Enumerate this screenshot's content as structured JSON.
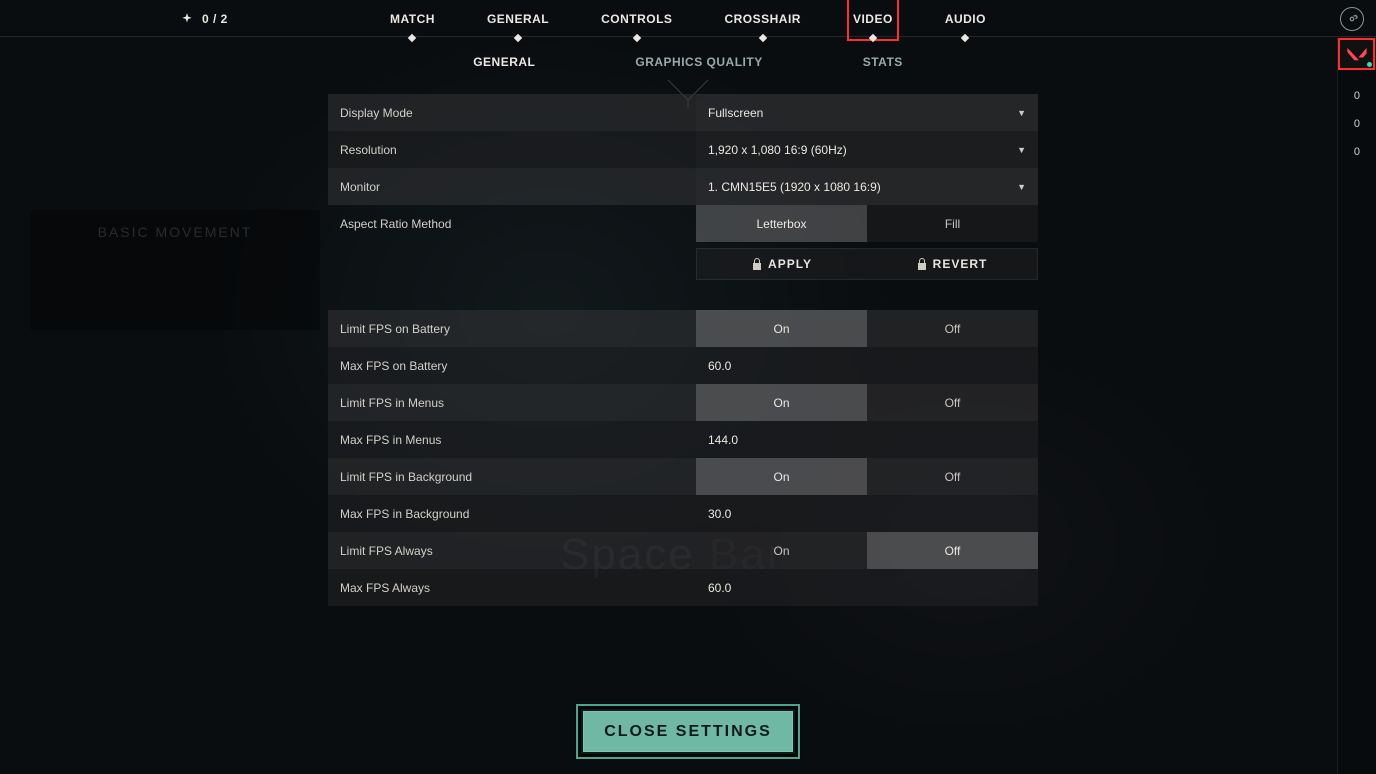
{
  "header": {
    "score": "0 / 2",
    "tabs": [
      "MATCH",
      "GENERAL",
      "CONTROLS",
      "CROSSHAIR",
      "VIDEO",
      "AUDIO"
    ],
    "active_tab_index": 4
  },
  "right_strip": {
    "stats": [
      "0",
      "0",
      "0"
    ]
  },
  "sub_tabs": {
    "items": [
      "GENERAL",
      "GRAPHICS QUALITY",
      "STATS"
    ],
    "active_index": 0
  },
  "settings": {
    "display_mode": {
      "label": "Display Mode",
      "value": "Fullscreen"
    },
    "resolution": {
      "label": "Resolution",
      "value": "1,920 x 1,080 16:9 (60Hz)"
    },
    "monitor": {
      "label": "Monitor",
      "value": "1. CMN15E5 (1920 x  1080 16:9)"
    },
    "aspect": {
      "label": "Aspect Ratio Method",
      "opts": [
        "Letterbox",
        "Fill"
      ],
      "sel": 0
    },
    "apply": "APPLY",
    "revert": "REVERT",
    "fps_batt_limit": {
      "label": "Limit FPS on Battery",
      "opts": [
        "On",
        "Off"
      ],
      "sel": 0
    },
    "fps_batt_max": {
      "label": "Max FPS on Battery",
      "value": "60.0"
    },
    "fps_menu_limit": {
      "label": "Limit FPS in Menus",
      "opts": [
        "On",
        "Off"
      ],
      "sel": 0
    },
    "fps_menu_max": {
      "label": "Max FPS in Menus",
      "value": "144.0"
    },
    "fps_bg_limit": {
      "label": "Limit FPS in Background",
      "opts": [
        "On",
        "Off"
      ],
      "sel": 0
    },
    "fps_bg_max": {
      "label": "Max FPS in Background",
      "value": "30.0"
    },
    "fps_always_limit": {
      "label": "Limit FPS Always",
      "opts": [
        "On",
        "Off"
      ],
      "sel": 1
    },
    "fps_always_max": {
      "label": "Max FPS Always",
      "value": "60.0"
    }
  },
  "bg_hint": {
    "title": "BASIC MOVEMENT",
    "spacebar": "Space Bar"
  },
  "close_label": "CLOSE SETTINGS"
}
